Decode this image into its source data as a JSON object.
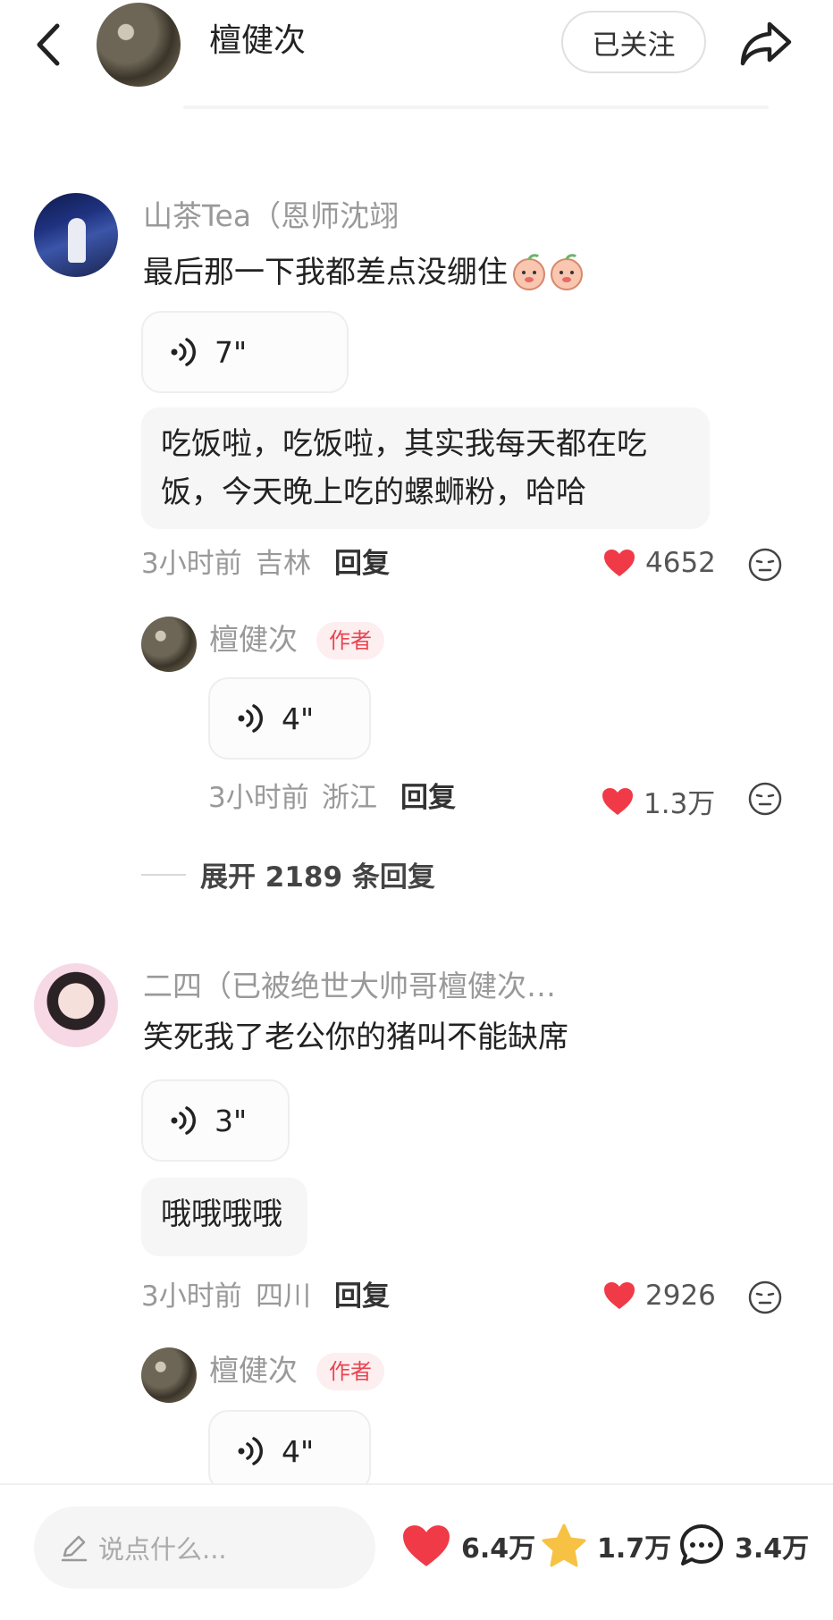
{
  "header": {
    "author_name": "檀健次",
    "follow_label": "已关注"
  },
  "comments": [
    {
      "user": "山茶Tea（恩师沈翊",
      "text": "最后那一下我都差点没绷住",
      "emoji": "[peach-face-emoji] x2",
      "voice_duration": "7\"",
      "bubble_lines": [
        "吃饭啦，吃饭啦，其实我每天都在吃",
        "饭，今天晚上吃的螺蛳粉，哈哈"
      ],
      "time": "3小时前",
      "location": "吉林",
      "reply_label": "回复",
      "likes": "4652",
      "author_reply": {
        "name": "檀健次",
        "tag": "作者",
        "voice_duration": "4\"",
        "time": "3小时前",
        "location": "浙江",
        "reply_label": "回复",
        "likes": "1.3万"
      },
      "expand_label": "展开 2189 条回复"
    },
    {
      "user": "二四（已被绝世大帅哥檀健次…",
      "text": "笑死我了老公你的猪叫不能缺席",
      "voice_duration": "3\"",
      "bubble_lines": [
        "哦哦哦哦"
      ],
      "time": "3小时前",
      "location": "四川",
      "reply_label": "回复",
      "likes": "2926",
      "author_reply": {
        "name": "檀健次",
        "tag": "作者",
        "voice_duration": "4\""
      }
    }
  ],
  "bottom_bar": {
    "input_placeholder": "说点什么...",
    "likes": "6.4万",
    "favorites": "1.7万",
    "comments": "3.4万"
  },
  "colors": {
    "like_red": "#f03a47",
    "star_yellow": "#f7c244",
    "author_tag_bg": "#fdeef0",
    "author_tag_text": "#e8454f"
  },
  "icons": [
    "back-arrow-icon",
    "share-icon",
    "voice-wave-icon",
    "heart-icon",
    "emoji-icon",
    "pencil-icon",
    "star-icon",
    "comment-bubble-icon"
  ]
}
